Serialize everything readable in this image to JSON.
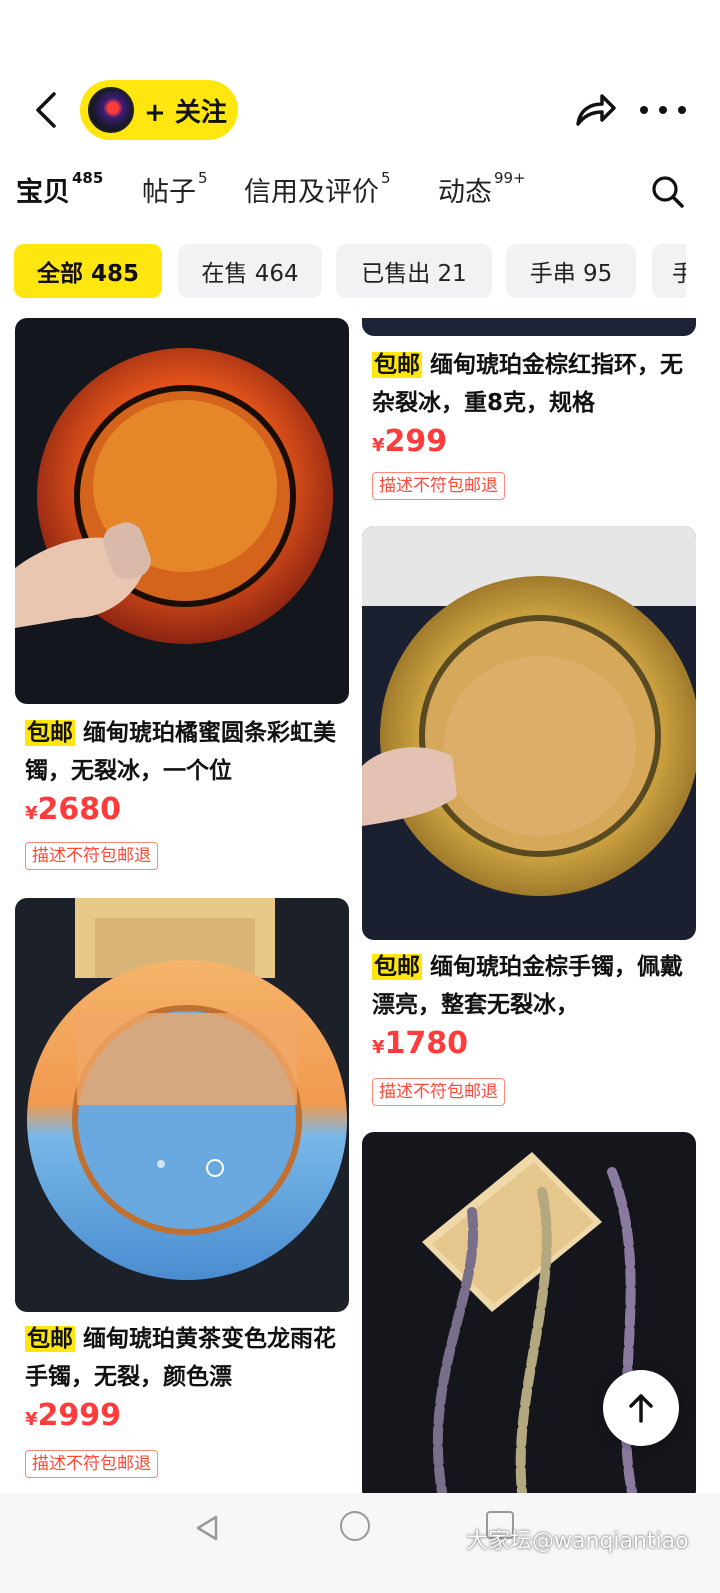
{
  "header": {
    "follow_label": "+ 关注"
  },
  "tabs": [
    {
      "label": "宝贝",
      "count": "485"
    },
    {
      "label": "帖子",
      "count": "5"
    },
    {
      "label": "信用及评价",
      "count": "5"
    },
    {
      "label": "动态",
      "count": "99+"
    }
  ],
  "filters": [
    "全部 485",
    "在售 464",
    "已售出 21",
    "手串 95",
    "手"
  ],
  "products": [
    {
      "tag": "包邮",
      "title": "缅甸琥珀金棕红指环，无杂裂冰，重8克，规格",
      "currency": "¥",
      "price": "299",
      "badge": "描述不符包邮退"
    },
    {
      "tag": "包邮",
      "title": "缅甸琥珀橘蜜圆条彩虹美镯，无裂冰，一个位",
      "currency": "¥",
      "price": "2680",
      "badge": "描述不符包邮退"
    },
    {
      "tag": "包邮",
      "title": "缅甸琥珀金棕手镯，佩戴漂亮，整套无裂冰，",
      "currency": "¥",
      "price": "1780",
      "badge": "描述不符包邮退"
    },
    {
      "tag": "包邮",
      "title": "缅甸琥珀黄茶变色龙雨花手镯，无裂，颜色漂",
      "currency": "¥",
      "price": "2999",
      "badge": "描述不符包邮退"
    }
  ],
  "watermark": "大家坛@wanqiantiao",
  "colors": {
    "accent_yellow": "#ffe60f",
    "price_red": "#ff3b3b"
  },
  "icons": [
    "back-arrow-icon",
    "share-icon",
    "more-dots-icon",
    "search-icon",
    "arrow-up-icon",
    "nav-back-icon",
    "nav-home-icon",
    "nav-recents-icon"
  ]
}
